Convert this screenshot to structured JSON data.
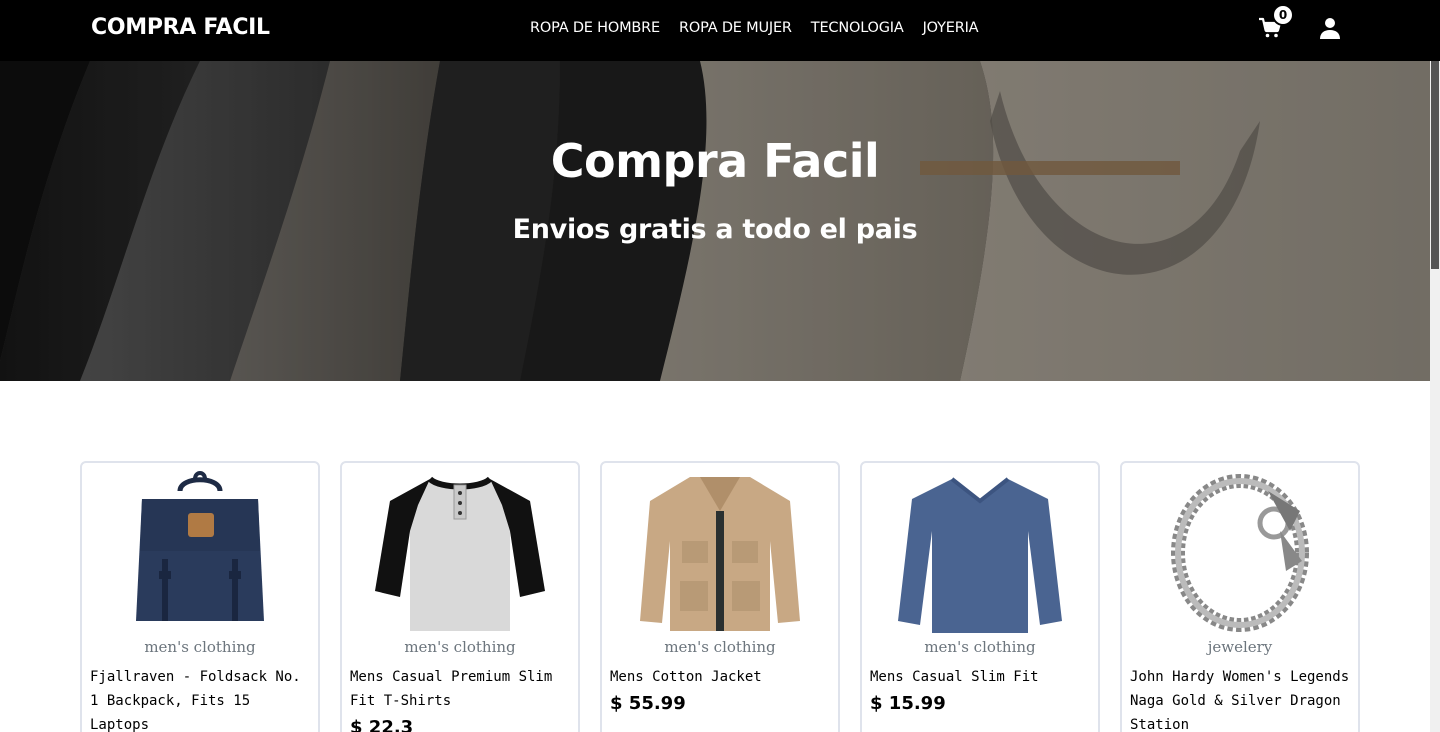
{
  "nav": {
    "brand": "COMPRA FACIL",
    "links": [
      "ROPA DE HOMBRE",
      "ROPA DE MUJER",
      "TECNOLOGIA",
      "JOYERIA"
    ],
    "cart_count": "0"
  },
  "hero": {
    "title": "Compra Facil",
    "subtitle": "Envios gratis a todo el pais"
  },
  "products": [
    {
      "category": "men's clothing",
      "title": "Fjallraven - Foldsack No. 1 Backpack, Fits 15 Laptops",
      "price": "",
      "image": "backpack"
    },
    {
      "category": "men's clothing",
      "title": "Mens Casual Premium Slim Fit T-Shirts",
      "price": "$ 22.3",
      "image": "henley-shirt"
    },
    {
      "category": "men's clothing",
      "title": "Mens Cotton Jacket",
      "price": "$ 55.99",
      "image": "jacket"
    },
    {
      "category": "men's clothing",
      "title": "Mens Casual Slim Fit",
      "price": "$ 15.99",
      "image": "long-sleeve-shirt"
    },
    {
      "category": "jewelery",
      "title": "John Hardy Women's Legends Naga Gold & Silver Dragon Station",
      "price": "",
      "image": "dragon-bracelet"
    }
  ],
  "colors": {
    "navbar": "#000000",
    "card_border": "#dfe3ec",
    "category_text": "#6c757d"
  }
}
